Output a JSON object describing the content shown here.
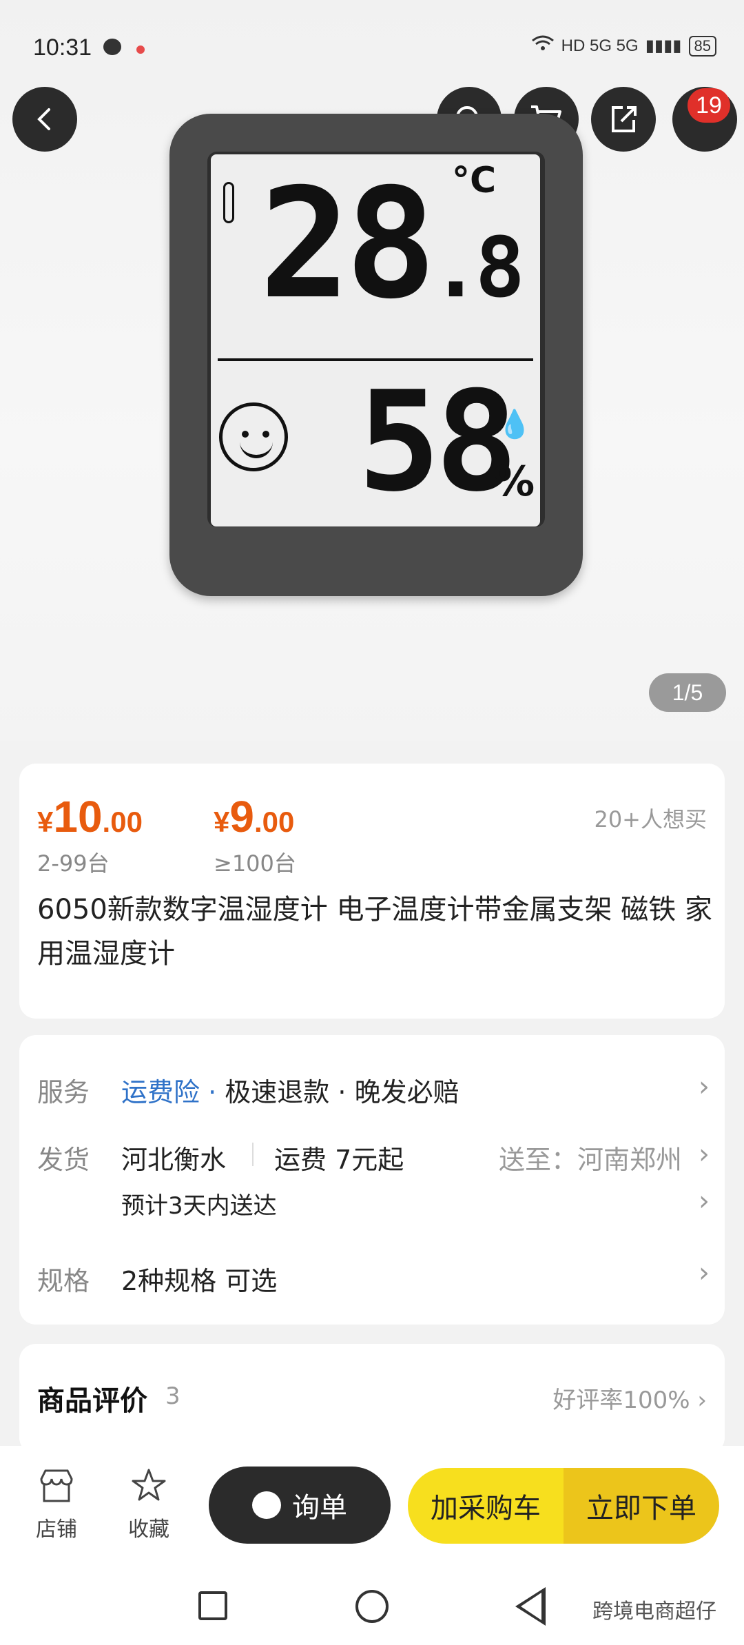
{
  "status_bar": {
    "time": "10:31",
    "signal_text": "HD 5G 5G",
    "battery": "85"
  },
  "top_actions": {
    "badge_count": "19"
  },
  "gallery": {
    "pager": "1/5"
  },
  "product_display": {
    "temp": "28",
    "temp_decimal": ".8",
    "temp_unit": "°C",
    "humidity": "58",
    "humidity_unit": "%"
  },
  "prices": [
    {
      "yen": "¥",
      "int": "10",
      "dec": ".00",
      "range": "2-99台"
    },
    {
      "yen": "¥",
      "int": "9",
      "dec": ".00",
      "range": "≥100台"
    }
  ],
  "want_text": "20+人想买",
  "title": "6050新款数字温湿度计 电子温度计带金属支架 磁铁 家用温湿度计",
  "service": {
    "label": "服务",
    "items": [
      "运费险",
      "·",
      "极速退款",
      "·",
      "晚发必赔"
    ]
  },
  "shipping": {
    "label": "发货",
    "origin": "河北衡水",
    "fee": "运费 7元起",
    "dest": "送至：河南郑州",
    "eta": "预计3天内送达"
  },
  "spec": {
    "label": "规格",
    "value": "2种规格 可选"
  },
  "review": {
    "title": "商品评价",
    "count": "3",
    "rate": "好评率100%"
  },
  "bottom": {
    "shop": "店铺",
    "fav": "收藏",
    "inquiry": "询单",
    "add_cart": "加采购车",
    "buy_now": "立即下单"
  },
  "watermark": "跨境电商超仔",
  "colors": {
    "price": "#e85b0e",
    "blue_link": "#2f72c8",
    "cta_left": "#f7df1e",
    "cta_right": "#ecc51b",
    "badge": "#e0302a"
  }
}
